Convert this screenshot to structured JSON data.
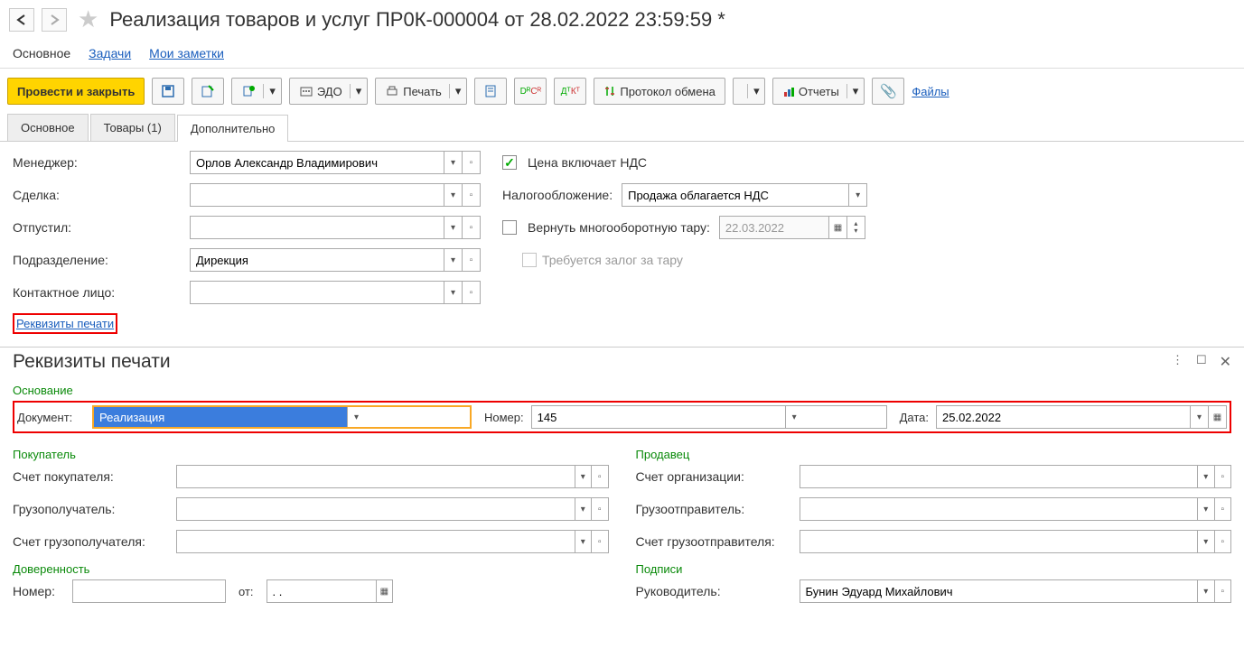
{
  "header": {
    "title": "Реализация товаров и услуг ПР0К-000004 от 28.02.2022 23:59:59 *"
  },
  "mainnav": {
    "main": "Основное",
    "tasks": "Задачи",
    "notes": "Мои заметки"
  },
  "toolbar": {
    "post_close": "Провести и закрыть",
    "edo": "ЭДО",
    "print": "Печать",
    "protocol": "Протокол обмена",
    "reports": "Отчеты",
    "files": "Файлы"
  },
  "tabs": {
    "main": "Основное",
    "goods": "Товары (1)",
    "extra": "Дополнительно"
  },
  "form": {
    "manager_lbl": "Менеджер:",
    "manager_val": "Орлов Александр Владимирович",
    "price_vat_lbl": "Цена включает НДС",
    "deal_lbl": "Сделка:",
    "tax_lbl": "Налогообложение:",
    "tax_val": "Продажа облагается НДС",
    "released_lbl": "Отпустил:",
    "return_tare_lbl": "Вернуть многооборотную тару:",
    "return_tare_date": "22.03.2022",
    "dept_lbl": "Подразделение:",
    "dept_val": "Дирекция",
    "deposit_lbl": "Требуется залог за тару",
    "contact_lbl": "Контактное лицо:",
    "print_req_link": "Реквизиты печати"
  },
  "panel": {
    "title": "Реквизиты печати",
    "basis_grp": "Основание",
    "doc_lbl": "Документ:",
    "doc_val": "Реализация",
    "num_lbl": "Номер:",
    "num_val": "145",
    "date_lbl": "Дата:",
    "date_val": "25.02.2022",
    "buyer_grp": "Покупатель",
    "seller_grp": "Продавец",
    "buyer_acct_lbl": "Счет покупателя:",
    "consignee_lbl": "Грузополучатель:",
    "consignee_acct_lbl": "Счет грузополучателя:",
    "org_acct_lbl": "Счет организации:",
    "consignor_lbl": "Грузоотправитель:",
    "consignor_acct_lbl": "Счет грузоотправителя:",
    "poa_grp": "Доверенность",
    "sign_grp": "Подписи",
    "poa_num_lbl": "Номер:",
    "poa_from_lbl": "от:",
    "poa_from_val": ". .",
    "head_lbl": "Руководитель:",
    "head_val": "Бунин Эдуард Михайлович"
  }
}
